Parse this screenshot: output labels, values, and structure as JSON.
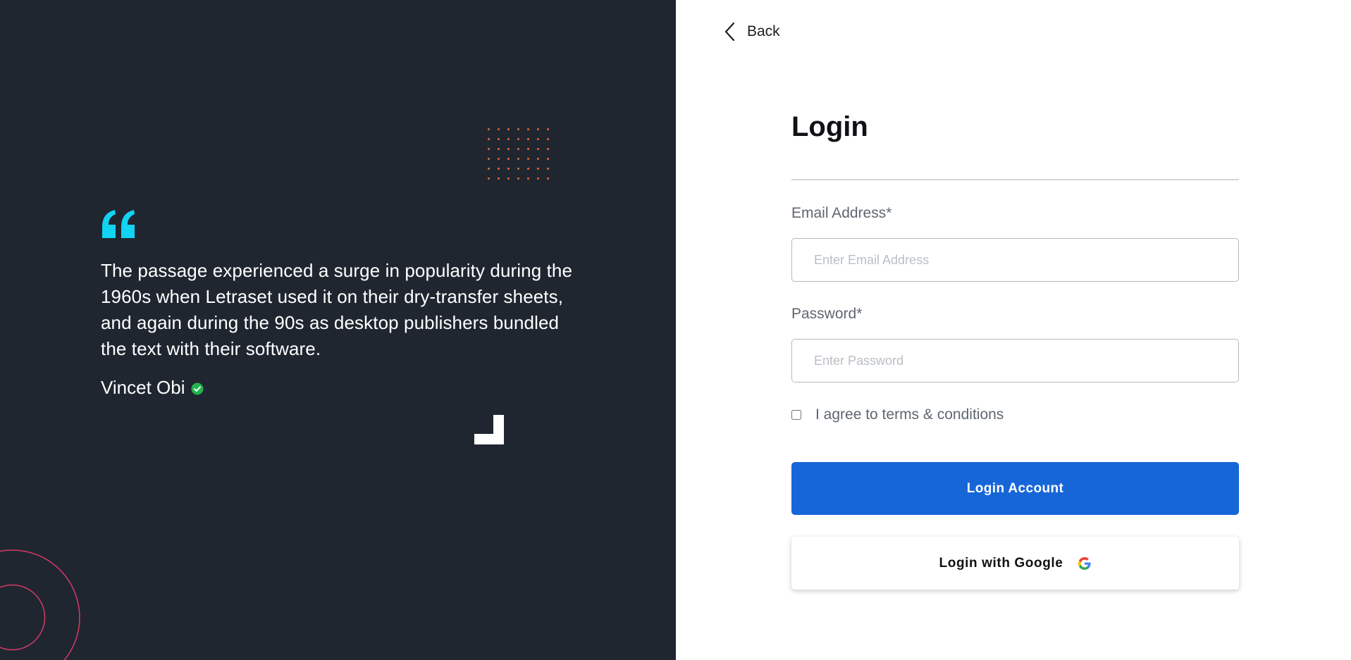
{
  "testimonial": {
    "quote": "The passage experienced a surge in popularity during the 1960s when Letraset used it on their dry-transfer sheets, and again during the 90s as desktop publishers bundled the text with their software.",
    "author": "Vincet Obi",
    "quote_icon": "quote-icon",
    "verified_icon": "verified-check-icon",
    "quote_color": "#12d3f2",
    "verified_color": "#23b24b"
  },
  "decor": {
    "dot_color": "#e2693d",
    "circle_color": "#d63a66",
    "panel_color": "#1f2630"
  },
  "nav": {
    "back_label": "Back",
    "back_icon": "chevron-left-icon"
  },
  "form": {
    "title": "Login",
    "email_label": "Email Address*",
    "email_placeholder": "Enter Email Address",
    "email_value": "",
    "password_label": "Password*",
    "password_placeholder": "Enter Password",
    "password_value": "",
    "terms_label": "I agree to terms & conditions",
    "terms_checked": false,
    "login_button": "Login Account",
    "google_button": "Login with Google",
    "google_icon": "google-icon",
    "accent_color": "#1766d8"
  }
}
